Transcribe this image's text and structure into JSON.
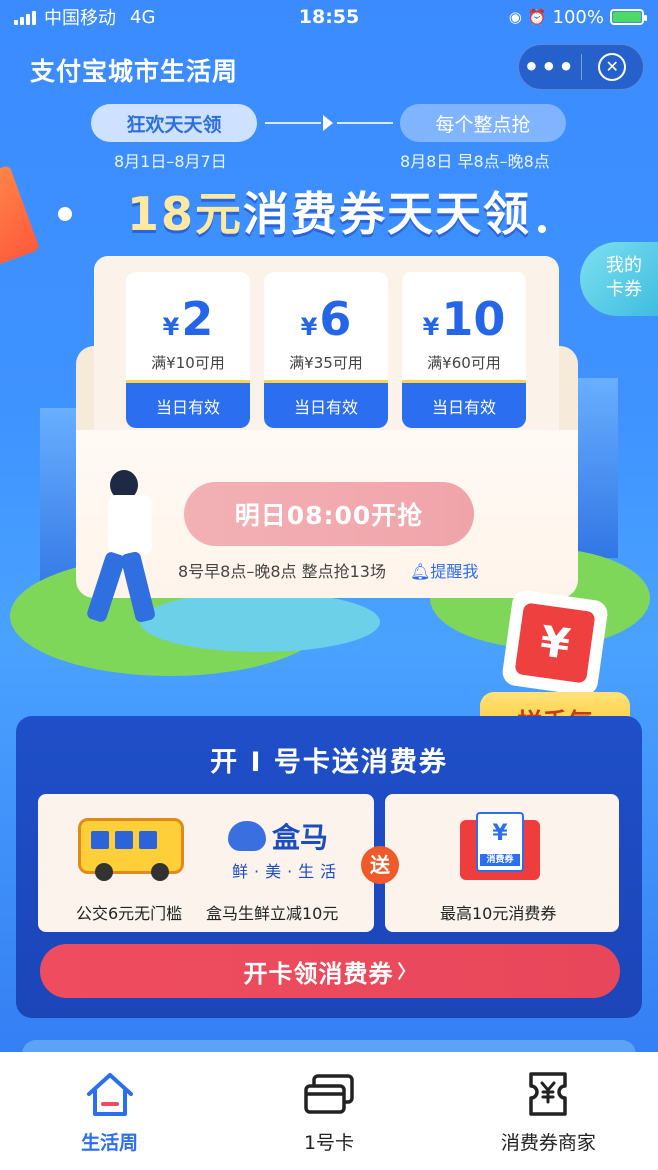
{
  "status_bar": {
    "carrier": "中国移动",
    "network": "4G",
    "time": "18:55",
    "battery": "100%",
    "battery_level": 1.0
  },
  "header": {
    "title": "支付宝城市生活周",
    "more_icon": "more-dots-icon",
    "close_icon": "close-circle-icon"
  },
  "phases": [
    {
      "label": "狂欢天天领",
      "date": "8月1日–8月7日",
      "active": true
    },
    {
      "label": "每个整点抢",
      "date": "8月8日 早8点–晚8点",
      "active": false
    }
  ],
  "headline": {
    "amount": "18元",
    "text": "消费券天天领"
  },
  "my_coupons": {
    "line1": "我的",
    "line2": "卡券"
  },
  "coupons": [
    {
      "currency": "¥",
      "value": "2",
      "condition": "满¥10可用",
      "validity": "当日有效"
    },
    {
      "currency": "¥",
      "value": "6",
      "condition": "满¥35可用",
      "validity": "当日有效"
    },
    {
      "currency": "¥",
      "value": "10",
      "condition": "满¥60可用",
      "validity": "当日有效"
    }
  ],
  "grab": {
    "button_label": "明日08:00开抢",
    "session_info": "8号早8点–晚8点  整点抢13场",
    "remind_label": "提醒我"
  },
  "red_packet": {
    "symbol": "¥",
    "button_label": "拼手气"
  },
  "promo": {
    "title": "开 I 号卡送消费券",
    "benefit_left_1": "公交6元无门槛",
    "benefit_left_2": "盒马生鲜立减10元",
    "hema_brand": "盒马",
    "hema_slogan": "鲜·美·生活",
    "send_badge": "送",
    "voucher_symbol": "¥",
    "voucher_tag": "消费券",
    "benefit_right": "最高10元消费券",
    "cta_label": "开卡领消费券",
    "cta_arrow": "〉"
  },
  "tabs": [
    {
      "label": "生活周",
      "icon": "home-icon",
      "active": true
    },
    {
      "label": "1号卡",
      "icon": "cards-icon",
      "active": false
    },
    {
      "label": "消费券商家",
      "icon": "voucher-icon",
      "active": false
    }
  ],
  "colors": {
    "primary_blue": "#2c6ef0",
    "cta_red": "#e8465a",
    "gold": "#ffc21a"
  }
}
